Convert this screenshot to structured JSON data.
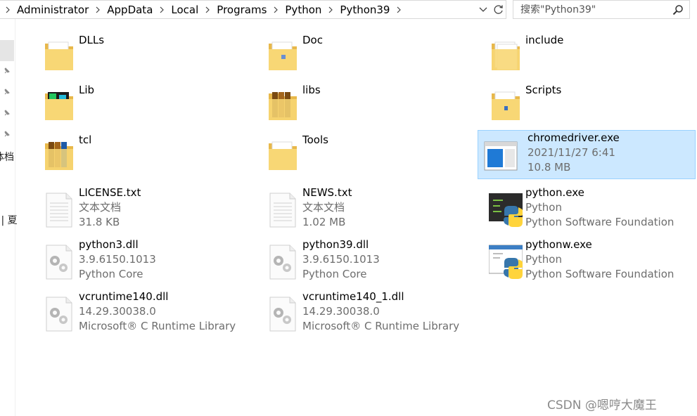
{
  "breadcrumb": [
    "Administrator",
    "AppData",
    "Local",
    "Programs",
    "Python",
    "Python39"
  ],
  "search": {
    "placeholder": "搜索\"Python39\""
  },
  "nav": {
    "partial_label_1": "体档",
    "partial_label_2": "‐ | 夏"
  },
  "items": [
    {
      "name": "DLLs",
      "line2": "",
      "line3": "",
      "icon": "folder-icon"
    },
    {
      "name": "Doc",
      "line2": "",
      "line3": "",
      "icon": "folder-icon"
    },
    {
      "name": "include",
      "line2": "",
      "line3": "",
      "icon": "folder-icon"
    },
    {
      "name": "Lib",
      "line2": "",
      "line3": "",
      "icon": "folder-icon"
    },
    {
      "name": "libs",
      "line2": "",
      "line3": "",
      "icon": "folder-icon"
    },
    {
      "name": "Scripts",
      "line2": "",
      "line3": "",
      "icon": "folder-icon"
    },
    {
      "name": "tcl",
      "line2": "",
      "line3": "",
      "icon": "folder-icon"
    },
    {
      "name": "Tools",
      "line2": "",
      "line3": "",
      "icon": "folder-icon"
    },
    {
      "name": "chromedriver.exe",
      "line2": "2021/11/27 6:41",
      "line3": "10.8 MB",
      "icon": "application-icon"
    },
    {
      "name": "LICENSE.txt",
      "line2": "文本文档",
      "line3": "31.8 KB",
      "icon": "text-file-icon"
    },
    {
      "name": "NEWS.txt",
      "line2": "文本文档",
      "line3": "1.02 MB",
      "icon": "text-file-icon"
    },
    {
      "name": "python.exe",
      "line2": "Python",
      "line3": "Python Software Foundation",
      "icon": "python-icon"
    },
    {
      "name": "python3.dll",
      "line2": "3.9.6150.1013",
      "line3": "Python Core",
      "icon": "dll-icon"
    },
    {
      "name": "python39.dll",
      "line2": "3.9.6150.1013",
      "line3": "Python Core",
      "icon": "dll-icon"
    },
    {
      "name": "pythonw.exe",
      "line2": "Python",
      "line3": "Python Software Foundation",
      "icon": "pythonw-icon"
    },
    {
      "name": "vcruntime140.dll",
      "line2": "14.29.30038.0",
      "line3": "Microsoft® C Runtime Library",
      "icon": "dll-icon"
    },
    {
      "name": "vcruntime140_1.dll",
      "line2": "14.29.30038.0",
      "line3": "Microsoft® C Runtime Library",
      "icon": "dll-icon"
    }
  ],
  "watermark": "CSDN @嗯哼大魔王",
  "colors": {
    "selection_bg": "#cce8ff",
    "selection_border": "#99d1ff",
    "folder": "#f8d775",
    "secondary_text": "#6d6d6d"
  }
}
